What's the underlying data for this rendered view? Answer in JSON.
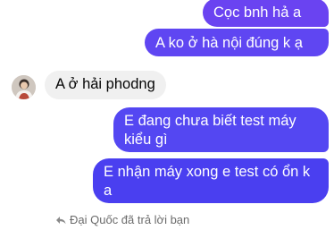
{
  "messages": [
    {
      "id": "msg1",
      "direction": "outgoing",
      "text": "Cọc bnh hả a"
    },
    {
      "id": "msg2",
      "direction": "outgoing",
      "text": "A ko ở hà nội đúng k ạ"
    },
    {
      "id": "msg3",
      "direction": "incoming",
      "text": "A ở hải phodng"
    },
    {
      "id": "msg4",
      "direction": "outgoing",
      "text": "E đang chưa biết test máy kiểu gì"
    },
    {
      "id": "msg5",
      "direction": "outgoing",
      "text": "E nhận máy xong e test có ổn k a"
    }
  ],
  "reply_note": {
    "icon": "reply-arrow-icon",
    "text": "Đại Quốc đã trả lời bạn"
  },
  "colors": {
    "outgoing_bubble": "#5447f2",
    "incoming_bubble": "#f0f0f0",
    "outgoing_text": "#ffffff",
    "incoming_text": "#050505",
    "meta_text": "#6b6b6b"
  }
}
